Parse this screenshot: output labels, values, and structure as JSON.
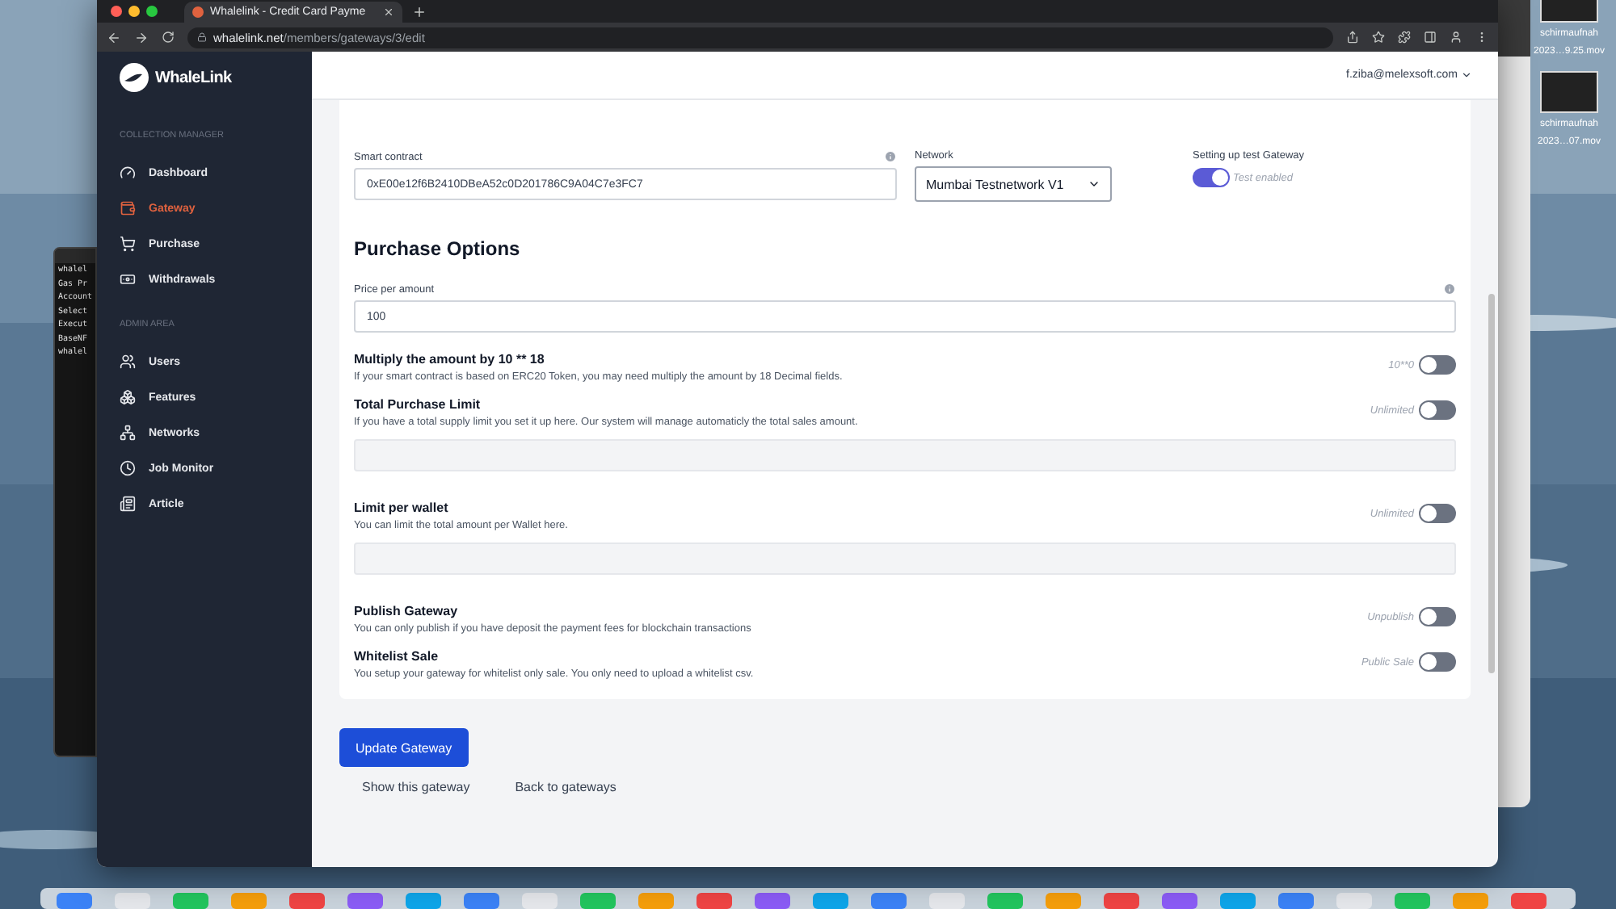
{
  "browser": {
    "tab_title": "Whalelink - Credit Card Payme",
    "url_host": "whalelink.net",
    "url_path": "/members/gateways/3/edit"
  },
  "sidebar": {
    "logo": "WhaleLink",
    "sections": [
      {
        "heading": "COLLECTION MANAGER",
        "items": [
          {
            "label": "Dashboard",
            "selected": false
          },
          {
            "label": "Gateway",
            "selected": true
          },
          {
            "label": "Purchase",
            "selected": false
          },
          {
            "label": "Withdrawals",
            "selected": false
          }
        ]
      },
      {
        "heading": "ADMIN AREA",
        "items": [
          {
            "label": "Users",
            "selected": false
          },
          {
            "label": "Features",
            "selected": false
          },
          {
            "label": "Networks",
            "selected": false
          },
          {
            "label": "Job Monitor",
            "selected": false
          },
          {
            "label": "Article",
            "selected": false
          }
        ]
      }
    ]
  },
  "header": {
    "user": "f.ziba@melexsoft.com"
  },
  "form": {
    "contract": {
      "label": "Smart contract",
      "value": "0xE00e12f6B2410DBeA52c0D201786C9A04C7e3FC7"
    },
    "network": {
      "label": "Network",
      "value": "Mumbai Testnetwork V1"
    },
    "test_gateway": {
      "label": "Setting up test Gateway",
      "on": true,
      "caption": "Test enabled"
    },
    "section_title": "Purchase Options",
    "price": {
      "label": "Price per amount",
      "value": "100"
    },
    "options": [
      {
        "title": "Multiply the amount by 10 ** 18",
        "description": "If your smart contract is based on ERC20 Token, you may need multiply the amount by 18 Decimal fields.",
        "caption": "10**0",
        "on": false,
        "has_field": false
      },
      {
        "title": "Total Purchase Limit",
        "description": "If you have a total supply limit you set it up here. Our system will manage automaticly the total sales amount.",
        "caption": "Unlimited",
        "on": false,
        "has_field": true
      },
      {
        "title": "Limit per wallet",
        "description": "You can limit the total amount per Wallet here.",
        "caption": "Unlimited",
        "on": false,
        "has_field": true
      },
      {
        "title": "Publish Gateway",
        "description": "You can only publish if you have deposit the payment fees for blockchain transactions",
        "caption": "Unpublish",
        "on": false,
        "has_field": false
      },
      {
        "title": "Whitelist Sale",
        "description": "You setup your gateway for whitelist only sale. You only need to upload a whitelist csv.",
        "caption": "Public Sale",
        "on": false,
        "has_field": false
      }
    ]
  },
  "actions": {
    "primary": "Update Gateway",
    "links": [
      "Show this gateway",
      "Back to gateways"
    ]
  },
  "terminal": {
    "lines": [
      "whalel",
      "Gas Pr",
      "Account",
      "Select",
      "Execut",
      "BaseNF",
      "whalel"
    ]
  },
  "desktop_files": [
    {
      "name": "schirmaufnah",
      "date": "2023…9.25.mov"
    },
    {
      "name": "schirmaufnah",
      "date": "2023…07.mov"
    }
  ]
}
